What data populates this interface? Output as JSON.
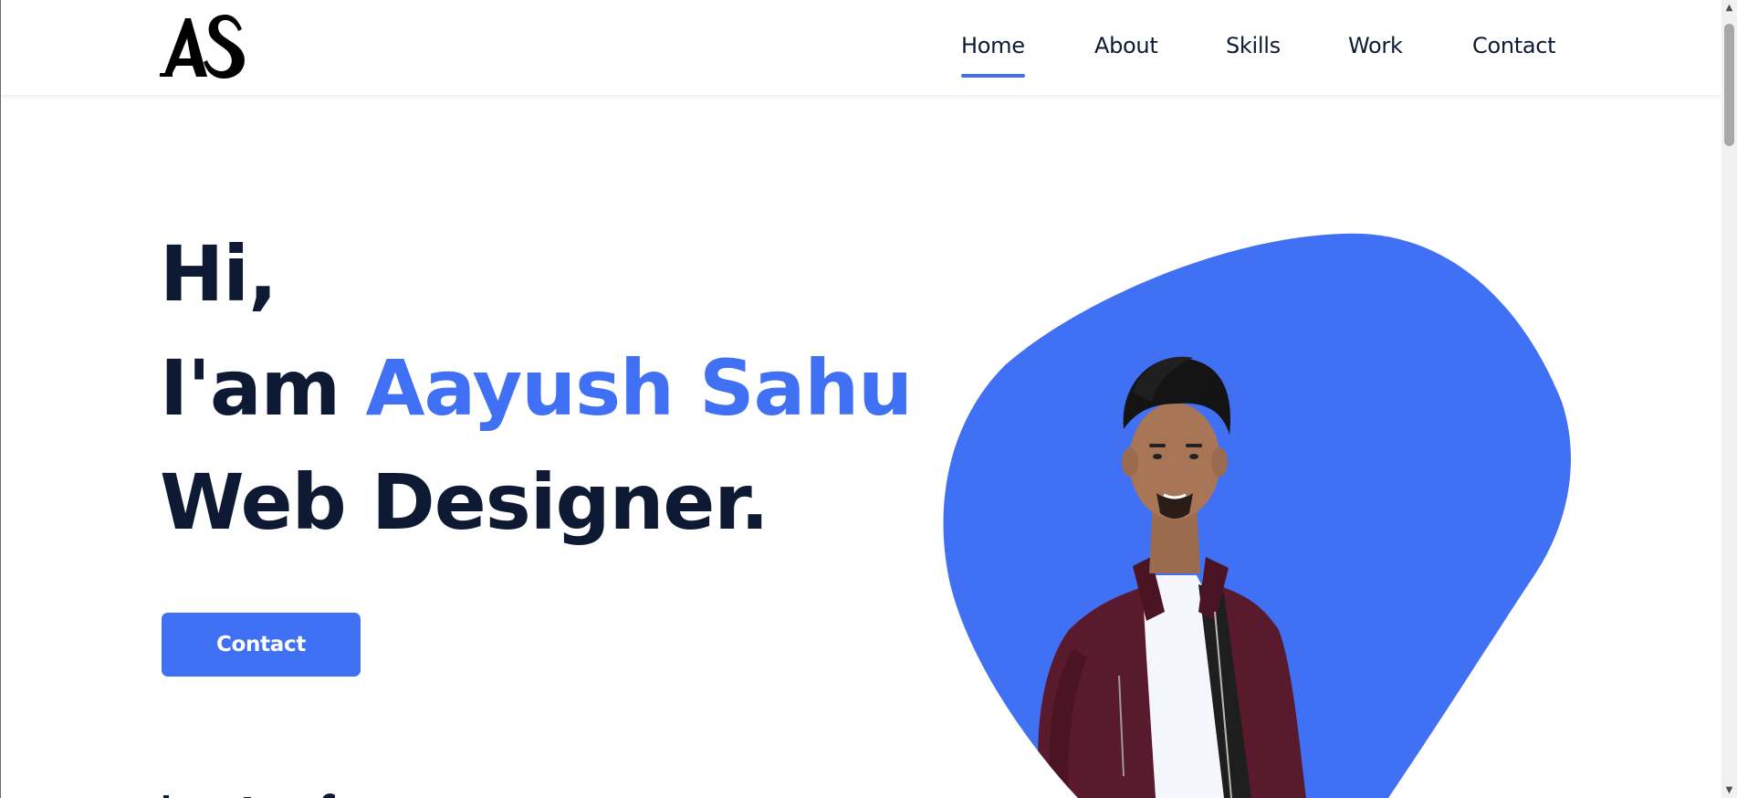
{
  "header": {
    "logo_text": "AS",
    "nav": [
      {
        "label": "Home",
        "active": true
      },
      {
        "label": "About",
        "active": false
      },
      {
        "label": "Skills",
        "active": false
      },
      {
        "label": "Work",
        "active": false
      },
      {
        "label": "Contact",
        "active": false
      }
    ]
  },
  "hero": {
    "line1": "Hi,",
    "line2_prefix": "I'am",
    "line2_name": "Aayush Sahu",
    "line3": "Web Designer.",
    "cta_label": "Contact"
  },
  "colors": {
    "accent": "#4070f4",
    "text_dark": "#0e1a33",
    "jacket": "#5a1a2e"
  },
  "icons": {
    "logo": "as-monogram-logo",
    "profile_photo": "profile-photo",
    "scroll_up": "scroll-up-arrow-icon",
    "scroll_down": "scroll-down-arrow-icon"
  }
}
